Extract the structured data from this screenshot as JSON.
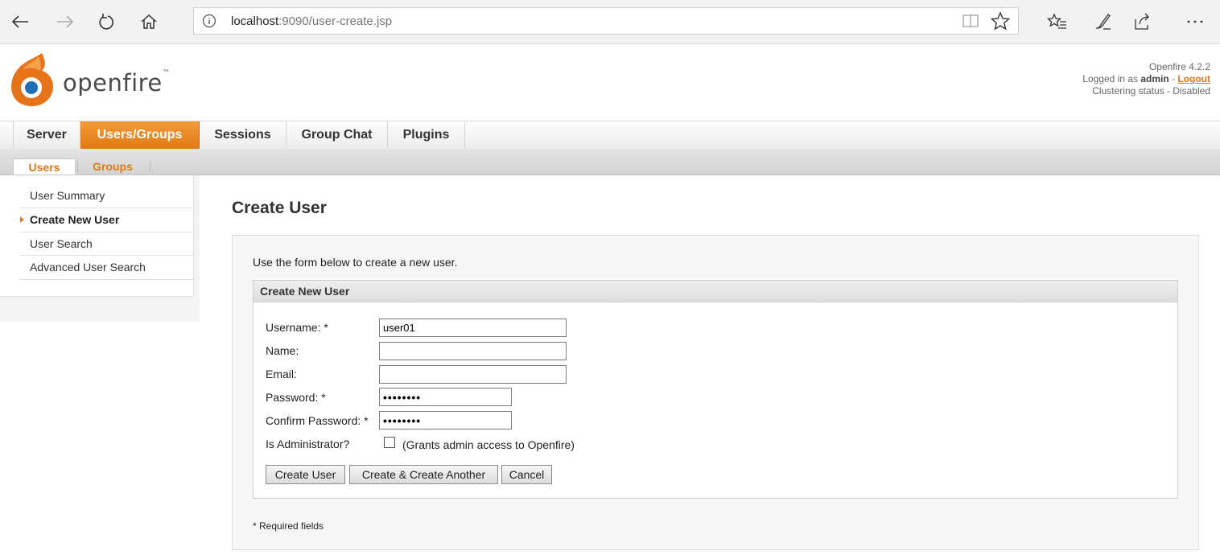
{
  "browser": {
    "url_host": "localhost",
    "url_rest": ":9090/user-create.jsp"
  },
  "header": {
    "brand": "openfire",
    "brand_tm": "™",
    "version": "Openfire 4.2.2",
    "logged_in_prefix": "Logged in as ",
    "user": "admin",
    "separator": " - ",
    "logout": "Logout",
    "clustering": "Clustering status - Disabled"
  },
  "main_tabs": [
    {
      "label": "Server"
    },
    {
      "label": "Users/Groups",
      "active": true
    },
    {
      "label": "Sessions"
    },
    {
      "label": "Group Chat"
    },
    {
      "label": "Plugins"
    }
  ],
  "sub_tabs": [
    {
      "label": "Users",
      "active": true
    },
    {
      "label": "Groups"
    }
  ],
  "sidebar": {
    "items": [
      {
        "label": "User Summary"
      },
      {
        "label": "Create New User",
        "active": true
      },
      {
        "label": "User Search"
      },
      {
        "label": "Advanced User Search"
      }
    ]
  },
  "content": {
    "title": "Create User",
    "intro": "Use the form below to create a new user.",
    "form_title": "Create New User",
    "fields": {
      "username": {
        "label": "Username: *",
        "value": "user01"
      },
      "name": {
        "label": "Name:",
        "value": ""
      },
      "email": {
        "label": "Email:",
        "value": ""
      },
      "password": {
        "label": "Password: *",
        "value": "••••••••"
      },
      "confirm": {
        "label": "Confirm Password: *",
        "value": "••••••••"
      },
      "is_admin": {
        "label": "Is Administrator?",
        "note": "(Grants admin access to Openfire)",
        "checked": false
      }
    },
    "buttons": {
      "create": "Create User",
      "create_another": "Create & Create Another",
      "cancel": "Cancel"
    },
    "required_note": "* Required fields"
  },
  "colors": {
    "accent": "#e07a13",
    "chrome": "#f2f2f2"
  }
}
